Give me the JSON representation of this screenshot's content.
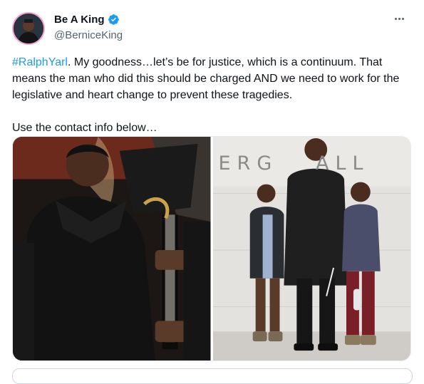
{
  "author": {
    "name": "Be A King",
    "handle": "@BerniceKing",
    "verified": true,
    "verified_icon": "verified-badge-icon",
    "more_icon": "more-options-icon"
  },
  "tweet": {
    "hashtag": "#RalphYarl",
    "body": ". My goodness…let’s be for justice, which is a continuum. That means the man who did this should be charged AND we need to work for the legislative and heart change to prevent these tragedies.",
    "line2": "Use the contact info below…"
  },
  "media": {
    "photo2_sign": "ERG   ALL"
  },
  "colors": {
    "link": "#1d9bf0",
    "text": "#0f1419",
    "secondary": "#536471",
    "avatar_ring": "#f3a6c9"
  }
}
